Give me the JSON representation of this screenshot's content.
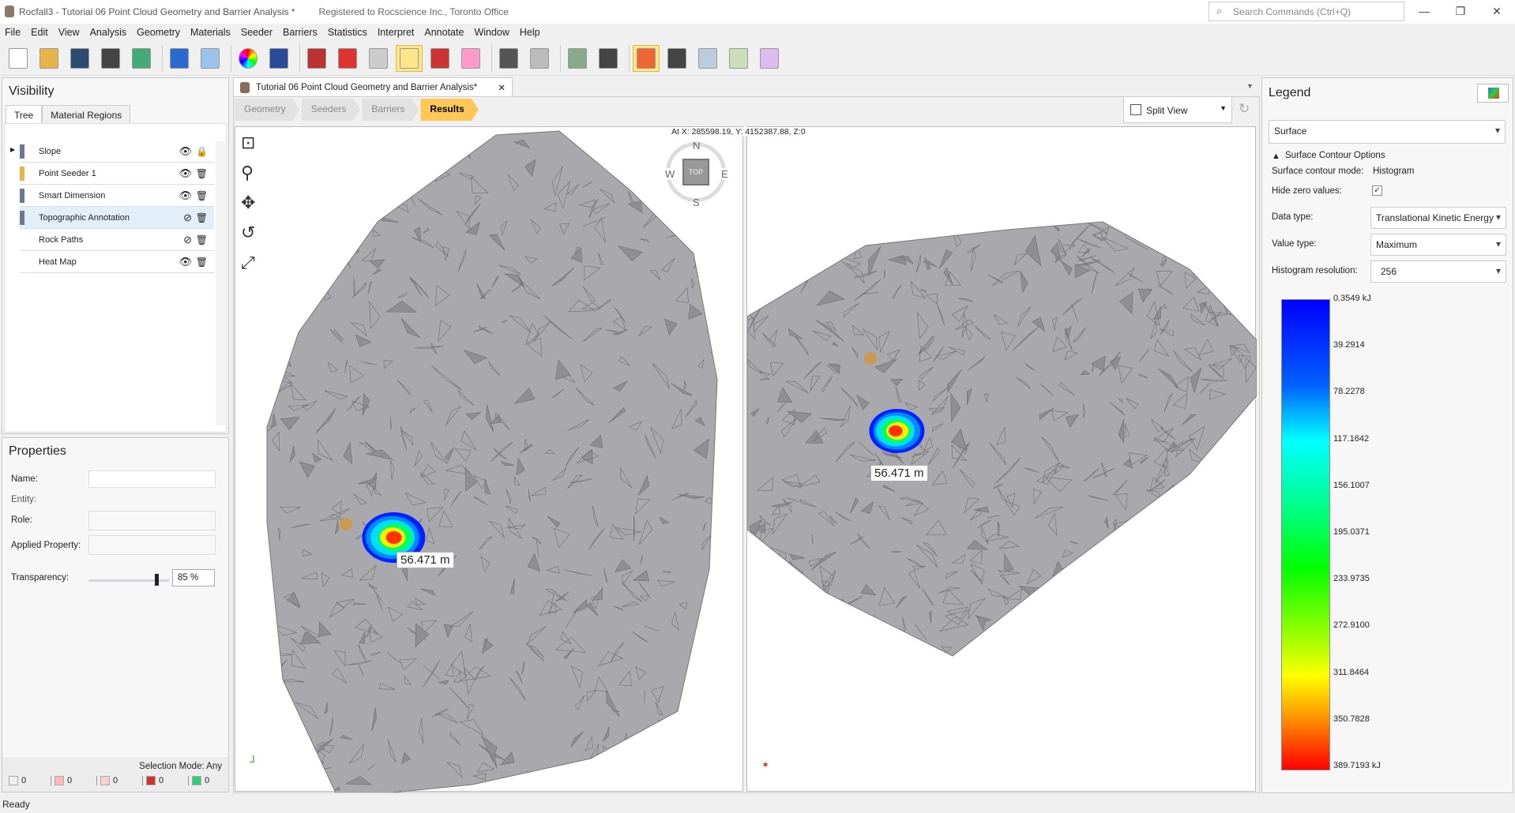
{
  "window": {
    "title": "Rocfall3 - Tutorial 06 Point Cloud Geometry and Barrier Analysis *",
    "registration": "Registered to Rocscience Inc., Toronto Office",
    "search_placeholder": "Search Commands (Ctrl+Q)"
  },
  "menu": [
    "File",
    "Edit",
    "View",
    "Analysis",
    "Geometry",
    "Materials",
    "Seeder",
    "Barriers",
    "Statistics",
    "Interpret",
    "Annotate",
    "Window",
    "Help"
  ],
  "toolbar": [
    "new-file-icon",
    "open-folder-icon",
    "save-icon",
    "print-icon",
    "report-icon",
    "undo-icon",
    "redo-icon",
    "color-wheel-icon",
    "background-image-icon",
    "edit-icon",
    "solid-red-cube-icon",
    "wireframe-cube-icon",
    "box-select-icon",
    "lock-select-icon",
    "clear-select-icon",
    "slope-profile-icon",
    "export-icon",
    "data-table-icon",
    "calculator-icon",
    "heat-map-icon",
    "rock-path-icon",
    "info-icon",
    "flag-icon",
    "barrier-icon"
  ],
  "visibility": {
    "title": "Visibility",
    "tabs": [
      "Tree",
      "Material Regions"
    ],
    "items": [
      {
        "label": "Slope",
        "visible": true,
        "locked": true,
        "color": "#6b7894"
      },
      {
        "label": "Point Seeder 1",
        "visible": true,
        "color": "#e8b44a"
      },
      {
        "label": "Smart Dimension",
        "visible": true,
        "color": "#6b7894"
      },
      {
        "label": "Topographic Annotation",
        "visible": false,
        "selected": true,
        "color": "#6b7894"
      },
      {
        "label": "Rock Paths",
        "visible": false
      },
      {
        "label": "Heat Map",
        "visible": true
      }
    ]
  },
  "properties": {
    "title": "Properties",
    "name_label": "Name:",
    "entity_label": "Entity:",
    "role_label": "Role:",
    "applied_label": "Applied Property:",
    "transparency_label": "Transparency:",
    "transparency_value": "85 %",
    "transparency_pct": 85,
    "selection_mode": "Selection Mode: Any",
    "counts": [
      "0",
      "0",
      "0",
      "0",
      "0"
    ]
  },
  "status": "Ready",
  "document": {
    "tab": "Tutorial 06 Point Cloud Geometry and Barrier Analysis*",
    "workflow": [
      "Geometry",
      "Seeders",
      "Barriers",
      "Results"
    ],
    "view_mode": "Split View",
    "coords": "At X: 285598.19, Y: 4152387.88, Z:0",
    "dimension_label": "56.471 m",
    "compass": {
      "n": "N",
      "s": "S",
      "e": "E",
      "w": "W",
      "top": "TOP"
    }
  },
  "legend": {
    "title": "Legend",
    "source": "Surface",
    "section": "Surface Contour Options",
    "mode_label": "Surface contour mode:",
    "mode_value": "Histogram",
    "hide_zero_label": "Hide zero values:",
    "hide_zero": true,
    "data_type_label": "Data type:",
    "data_type": "Translational Kinetic Energy",
    "value_type_label": "Value type:",
    "value_type": "Maximum",
    "resolution_label": "Histogram resolution:",
    "resolution": "256",
    "ticks": [
      "0.3549 kJ",
      "39.2914",
      "78.2278",
      "117.1642",
      "156.1007",
      "195.0371",
      "233.9735",
      "272.9100",
      "311.8464",
      "350.7828",
      "389.7193 kJ"
    ]
  }
}
